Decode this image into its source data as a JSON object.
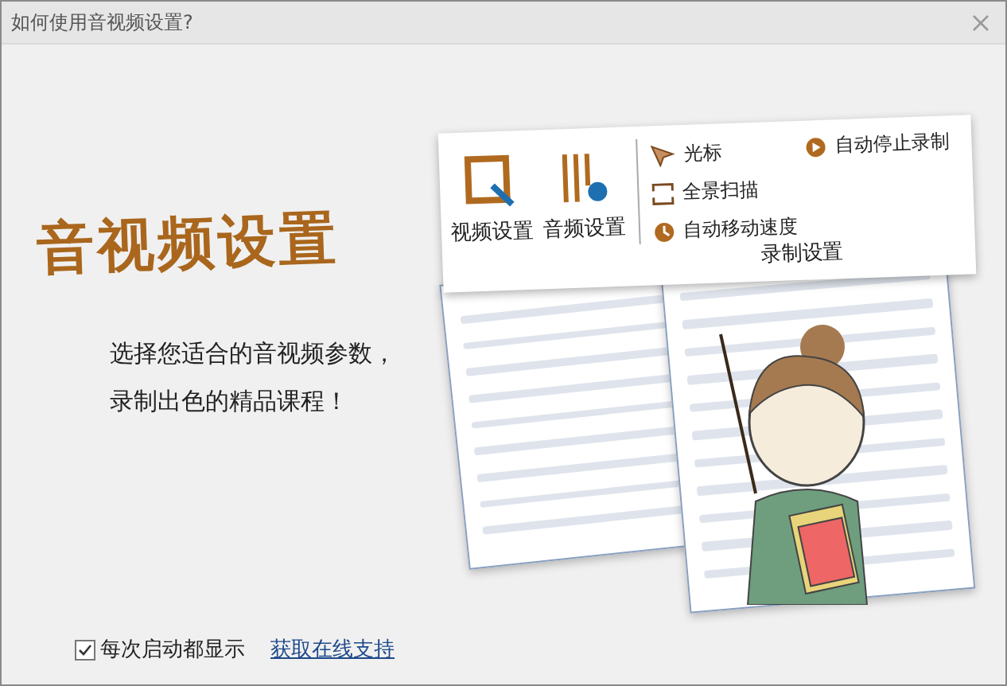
{
  "window": {
    "title": "如何使用音视频设置?"
  },
  "heading": "音视频设置",
  "description": [
    "选择您适合的音视频参数，",
    "录制出色的精品课程！"
  ],
  "ribbon": {
    "large_buttons": [
      {
        "label": "视频设置"
      },
      {
        "label": "音频设置"
      }
    ],
    "items": [
      {
        "label": "光标"
      },
      {
        "label": "全景扫描"
      },
      {
        "label": "自动移动速度"
      }
    ],
    "extra": "自动停止录制",
    "group_label": "录制设置"
  },
  "footer": {
    "show_on_startup": {
      "label": "每次启动都显示",
      "checked": true
    },
    "link": "获取在线支持"
  }
}
